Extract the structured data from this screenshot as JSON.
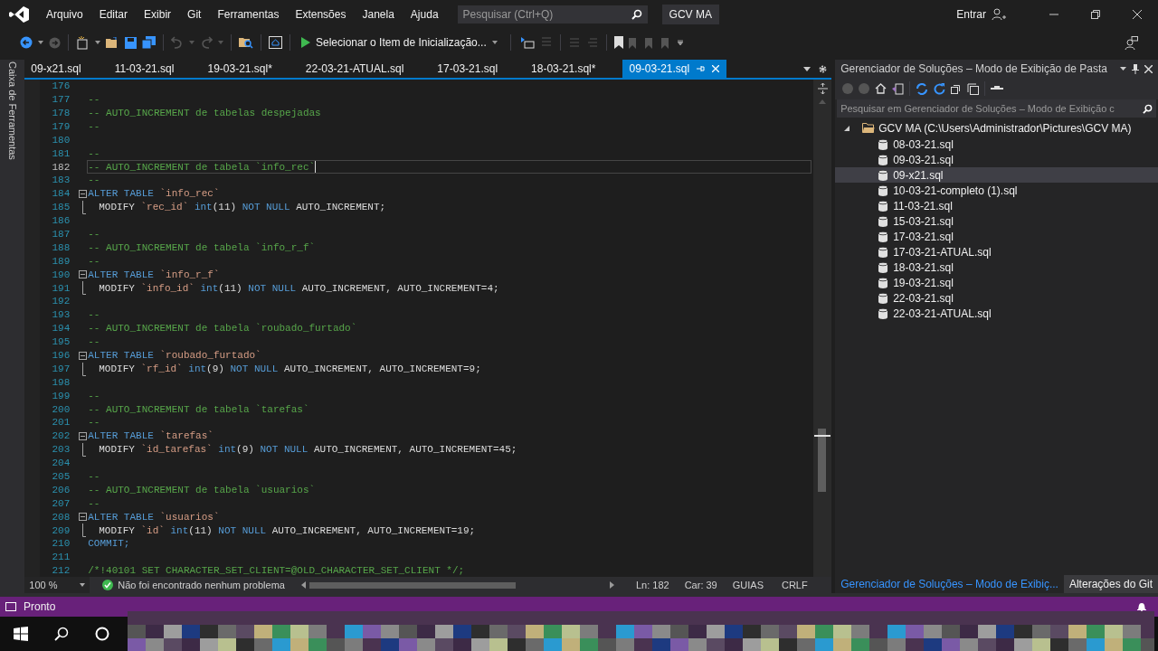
{
  "menu": [
    "Arquivo",
    "Editar",
    "Exibir",
    "Git",
    "Ferramentas",
    "Extensões",
    "Janela",
    "Ajuda"
  ],
  "search": {
    "placeholder": "Pesquisar (Ctrl+Q)"
  },
  "solution_badge": "GCV MA",
  "account": "Entrar",
  "startup_item": "Selecionar o Item de Inicialização...",
  "toolbox_label": "Caixa de Ferramentas",
  "tabs": [
    {
      "label": "09-x21.sql",
      "selected": false
    },
    {
      "label": "11-03-21.sql",
      "selected": false
    },
    {
      "label": "19-03-21.sql*",
      "selected": false
    },
    {
      "label": "22-03-21-ATUAL.sql",
      "selected": false
    },
    {
      "label": "17-03-21.sql",
      "selected": false
    },
    {
      "label": "18-03-21.sql*",
      "selected": false
    },
    {
      "label": "09-03-21.sql",
      "selected": true
    }
  ],
  "editor": {
    "lines": [
      {
        "number": "176",
        "kind": "plain",
        "current": false
      },
      {
        "number": "177",
        "kind": "plain",
        "current": false,
        "tokens": [
          {
            "kind": "comment",
            "text": "--"
          }
        ]
      },
      {
        "number": "178",
        "kind": "plain",
        "current": false,
        "tokens": [
          {
            "kind": "comment",
            "text": "-- AUTO_INCREMENT de tabelas despejadas"
          }
        ]
      },
      {
        "number": "179",
        "kind": "plain",
        "current": false,
        "tokens": [
          {
            "kind": "comment",
            "text": "--"
          }
        ]
      },
      {
        "number": "180",
        "kind": "plain",
        "current": false
      },
      {
        "number": "181",
        "kind": "plain",
        "current": false,
        "tokens": [
          {
            "kind": "comment",
            "text": "--"
          }
        ]
      },
      {
        "number": "182",
        "kind": "plain",
        "current": true,
        "tokens": [
          {
            "kind": "comment",
            "text": "-- AUTO_INCREMENT de tabela `info_rec`"
          }
        ]
      },
      {
        "number": "183",
        "kind": "plain",
        "current": false,
        "tokens": [
          {
            "kind": "comment",
            "text": "--"
          }
        ]
      },
      {
        "number": "184",
        "kind": "fold",
        "current": false,
        "tokens": [
          {
            "kind": "keyword",
            "text": "ALTER TABLE "
          },
          {
            "kind": "string",
            "text": "`info_rec`"
          }
        ]
      },
      {
        "number": "185",
        "kind": "guide",
        "current": false,
        "tokens": [
          {
            "kind": "plain",
            "text": "MODIFY "
          },
          {
            "kind": "string",
            "text": "`rec_id`"
          },
          {
            "kind": "keyword",
            "text": " int"
          },
          {
            "kind": "plain",
            "text": "(11) "
          },
          {
            "kind": "keyword",
            "text": "NOT NULL"
          },
          {
            "kind": "plain",
            "text": " AUTO_INCREMENT;"
          }
        ]
      },
      {
        "number": "186",
        "kind": "plain",
        "current": false
      },
      {
        "number": "187",
        "kind": "plain",
        "current": false,
        "tokens": [
          {
            "kind": "comment",
            "text": "--"
          }
        ]
      },
      {
        "number": "188",
        "kind": "plain",
        "current": false,
        "tokens": [
          {
            "kind": "comment",
            "text": "-- AUTO_INCREMENT de tabela `info_r_f`"
          }
        ]
      },
      {
        "number": "189",
        "kind": "plain",
        "current": false,
        "tokens": [
          {
            "kind": "comment",
            "text": "--"
          }
        ]
      },
      {
        "number": "190",
        "kind": "fold",
        "current": false,
        "tokens": [
          {
            "kind": "keyword",
            "text": "ALTER TABLE "
          },
          {
            "kind": "string",
            "text": "`info_r_f`"
          }
        ]
      },
      {
        "number": "191",
        "kind": "guide",
        "current": false,
        "tokens": [
          {
            "kind": "plain",
            "text": "MODIFY "
          },
          {
            "kind": "string",
            "text": "`info_id`"
          },
          {
            "kind": "keyword",
            "text": " int"
          },
          {
            "kind": "plain",
            "text": "(11) "
          },
          {
            "kind": "keyword",
            "text": "NOT NULL"
          },
          {
            "kind": "plain",
            "text": " AUTO_INCREMENT, AUTO_INCREMENT=4;"
          }
        ]
      },
      {
        "number": "192",
        "kind": "plain",
        "current": false
      },
      {
        "number": "193",
        "kind": "plain",
        "current": false,
        "tokens": [
          {
            "kind": "comment",
            "text": "--"
          }
        ]
      },
      {
        "number": "194",
        "kind": "plain",
        "current": false,
        "tokens": [
          {
            "kind": "comment",
            "text": "-- AUTO_INCREMENT de tabela `roubado_furtado`"
          }
        ]
      },
      {
        "number": "195",
        "kind": "plain",
        "current": false,
        "tokens": [
          {
            "kind": "comment",
            "text": "--"
          }
        ]
      },
      {
        "number": "196",
        "kind": "fold",
        "current": false,
        "tokens": [
          {
            "kind": "keyword",
            "text": "ALTER TABLE "
          },
          {
            "kind": "string",
            "text": "`roubado_furtado`"
          }
        ]
      },
      {
        "number": "197",
        "kind": "guide",
        "current": false,
        "tokens": [
          {
            "kind": "plain",
            "text": "MODIFY "
          },
          {
            "kind": "string",
            "text": "`rf_id`"
          },
          {
            "kind": "keyword",
            "text": " int"
          },
          {
            "kind": "plain",
            "text": "(9) "
          },
          {
            "kind": "keyword",
            "text": "NOT NULL"
          },
          {
            "kind": "plain",
            "text": " AUTO_INCREMENT, AUTO_INCREMENT=9;"
          }
        ]
      },
      {
        "number": "198",
        "kind": "plain",
        "current": false
      },
      {
        "number": "199",
        "kind": "plain",
        "current": false,
        "tokens": [
          {
            "kind": "comment",
            "text": "--"
          }
        ]
      },
      {
        "number": "200",
        "kind": "plain",
        "current": false,
        "tokens": [
          {
            "kind": "comment",
            "text": "-- AUTO_INCREMENT de tabela `tarefas`"
          }
        ]
      },
      {
        "number": "201",
        "kind": "plain",
        "current": false,
        "tokens": [
          {
            "kind": "comment",
            "text": "--"
          }
        ]
      },
      {
        "number": "202",
        "kind": "fold",
        "current": false,
        "tokens": [
          {
            "kind": "keyword",
            "text": "ALTER TABLE "
          },
          {
            "kind": "string",
            "text": "`tarefas`"
          }
        ]
      },
      {
        "number": "203",
        "kind": "guide",
        "current": false,
        "tokens": [
          {
            "kind": "plain",
            "text": "MODIFY "
          },
          {
            "kind": "string",
            "text": "`id_tarefas`"
          },
          {
            "kind": "keyword",
            "text": " int"
          },
          {
            "kind": "plain",
            "text": "(9) "
          },
          {
            "kind": "keyword",
            "text": "NOT NULL"
          },
          {
            "kind": "plain",
            "text": " AUTO_INCREMENT, AUTO_INCREMENT=45;"
          }
        ]
      },
      {
        "number": "204",
        "kind": "plain",
        "current": false
      },
      {
        "number": "205",
        "kind": "plain",
        "current": false,
        "tokens": [
          {
            "kind": "comment",
            "text": "--"
          }
        ]
      },
      {
        "number": "206",
        "kind": "plain",
        "current": false,
        "tokens": [
          {
            "kind": "comment",
            "text": "-- AUTO_INCREMENT de tabela `usuarios`"
          }
        ]
      },
      {
        "number": "207",
        "kind": "plain",
        "current": false,
        "tokens": [
          {
            "kind": "comment",
            "text": "--"
          }
        ]
      },
      {
        "number": "208",
        "kind": "fold",
        "current": false,
        "tokens": [
          {
            "kind": "keyword",
            "text": "ALTER TABLE "
          },
          {
            "kind": "string",
            "text": "`usuarios`"
          }
        ]
      },
      {
        "number": "209",
        "kind": "guide",
        "current": false,
        "tokens": [
          {
            "kind": "plain",
            "text": "MODIFY "
          },
          {
            "kind": "string",
            "text": "`id`"
          },
          {
            "kind": "keyword",
            "text": " int"
          },
          {
            "kind": "plain",
            "text": "(11) "
          },
          {
            "kind": "keyword",
            "text": "NOT NULL"
          },
          {
            "kind": "plain",
            "text": " AUTO_INCREMENT, AUTO_INCREMENT=19;"
          }
        ]
      },
      {
        "number": "210",
        "kind": "plain",
        "current": false,
        "tokens": [
          {
            "kind": "keyword",
            "text": "COMMIT;"
          }
        ]
      },
      {
        "number": "211",
        "kind": "plain",
        "current": false
      },
      {
        "number": "212",
        "kind": "plain",
        "current": false,
        "tokens": [
          {
            "kind": "comment",
            "text": "/*!40101 SET CHARACTER_SET_CLIENT=@OLD_CHARACTER_SET_CLIENT */;"
          }
        ]
      }
    ]
  },
  "editor_status": {
    "zoom": "100 %",
    "problems": "Não foi encontrado nenhum problema",
    "line": "Ln: 182",
    "column": "Car: 39",
    "indent": "GUIAS",
    "line_ending": "CRLF"
  },
  "solution_explorer": {
    "title": "Gerenciador de Soluções – Modo de Exibição de Pasta",
    "search": {
      "placeholder": "Pesquisar em Gerenciador de Soluções – Modo de Exibição c"
    },
    "tree": {
      "label": "GCV MA (C:\\Users\\Administrador\\Pictures\\GCV MA)",
      "expanded": true,
      "children": [
        {
          "label": "08-03-21.sql",
          "selected": false
        },
        {
          "label": "09-03-21.sql",
          "selected": false
        },
        {
          "label": "09-x21.sql",
          "selected": true
        },
        {
          "label": "10-03-21-completo (1).sql",
          "selected": false
        },
        {
          "label": "11-03-21.sql",
          "selected": false
        },
        {
          "label": "15-03-21.sql",
          "selected": false
        },
        {
          "label": "17-03-21.sql",
          "selected": false
        },
        {
          "label": "17-03-21-ATUAL.sql",
          "selected": false
        },
        {
          "label": "18-03-21.sql",
          "selected": false
        },
        {
          "label": "19-03-21.sql",
          "selected": false
        },
        {
          "label": "22-03-21.sql",
          "selected": false
        },
        {
          "label": "22-03-21-ATUAL.sql",
          "selected": false
        }
      ]
    }
  },
  "panel_tabs": [
    {
      "label": "Gerenciador de Soluções – Modo de Exibiç...",
      "selected": true
    },
    {
      "label": "Alterações do Git",
      "selected": false
    }
  ],
  "status_bar": {
    "text": "Pronto"
  }
}
